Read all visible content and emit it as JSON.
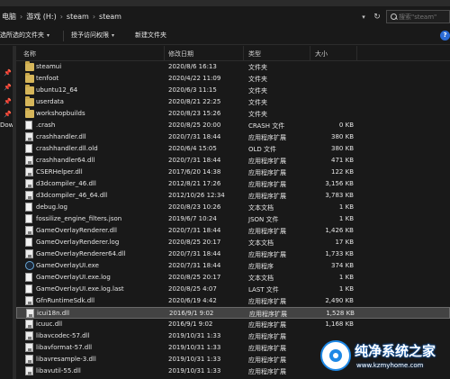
{
  "address": {
    "crumbs": [
      "电脑",
      "游戏 (H:)",
      "steam",
      "steam"
    ],
    "separator": "›",
    "chevron_icon": "▾",
    "refresh_icon": "↻",
    "search_placeholder": "搜索\"steam\""
  },
  "toolbar": {
    "select_label": "选所选的文件夹",
    "share_label": "授予访问权限",
    "new_folder_label": "新建文件夹",
    "chevron_icon": "▾",
    "help_icon": "?"
  },
  "nav": {
    "pin_icon": "📌",
    "downloads_label": "Dow"
  },
  "columns": {
    "name": "名称",
    "date": "修改日期",
    "type": "类型",
    "size": "大小"
  },
  "files": [
    {
      "name": "steamui",
      "date": "2020/8/6 16:13",
      "type": "文件夹",
      "size": "",
      "icon": "folder"
    },
    {
      "name": "tenfoot",
      "date": "2020/4/22 11:09",
      "type": "文件夹",
      "size": "",
      "icon": "folder"
    },
    {
      "name": "ubuntu12_64",
      "date": "2020/6/3 11:15",
      "type": "文件夹",
      "size": "",
      "icon": "folder"
    },
    {
      "name": "userdata",
      "date": "2020/8/21 22:25",
      "type": "文件夹",
      "size": "",
      "icon": "folder"
    },
    {
      "name": "workshopbuilds",
      "date": "2020/8/23 15:26",
      "type": "文件夹",
      "size": "",
      "icon": "folder"
    },
    {
      "name": ".crash",
      "date": "2020/8/25 20:00",
      "type": "CRASH 文件",
      "size": "0 KB",
      "icon": "file"
    },
    {
      "name": "crashhandler.dll",
      "date": "2020/7/31 18:44",
      "type": "应用程序扩展",
      "size": "380 KB",
      "icon": "dll"
    },
    {
      "name": "crashhandler.dll.old",
      "date": "2020/6/4 15:05",
      "type": "OLD 文件",
      "size": "380 KB",
      "icon": "file"
    },
    {
      "name": "crashhandler64.dll",
      "date": "2020/7/31 18:44",
      "type": "应用程序扩展",
      "size": "471 KB",
      "icon": "dll"
    },
    {
      "name": "CSERHelper.dll",
      "date": "2017/6/20 14:38",
      "type": "应用程序扩展",
      "size": "122 KB",
      "icon": "dll"
    },
    {
      "name": "d3dcompiler_46.dll",
      "date": "2012/8/21 17:26",
      "type": "应用程序扩展",
      "size": "3,156 KB",
      "icon": "dll"
    },
    {
      "name": "d3dcompiler_46_64.dll",
      "date": "2012/10/26 12:34",
      "type": "应用程序扩展",
      "size": "3,783 KB",
      "icon": "dll"
    },
    {
      "name": "debug.log",
      "date": "2020/8/23 10:26",
      "type": "文本文档",
      "size": "1 KB",
      "icon": "file"
    },
    {
      "name": "fossilize_engine_filters.json",
      "date": "2019/6/7 10:24",
      "type": "JSON 文件",
      "size": "1 KB",
      "icon": "file"
    },
    {
      "name": "GameOverlayRenderer.dll",
      "date": "2020/7/31 18:44",
      "type": "应用程序扩展",
      "size": "1,426 KB",
      "icon": "dll"
    },
    {
      "name": "GameOverlayRenderer.log",
      "date": "2020/8/25 20:17",
      "type": "文本文档",
      "size": "17 KB",
      "icon": "file"
    },
    {
      "name": "GameOverlayRenderer64.dll",
      "date": "2020/7/31 18:44",
      "type": "应用程序扩展",
      "size": "1,733 KB",
      "icon": "dll"
    },
    {
      "name": "GameOverlayUI.exe",
      "date": "2020/7/31 18:44",
      "type": "应用程序",
      "size": "374 KB",
      "icon": "exe"
    },
    {
      "name": "GameOverlayUI.exe.log",
      "date": "2020/8/25 20:17",
      "type": "文本文档",
      "size": "1 KB",
      "icon": "file"
    },
    {
      "name": "GameOverlayUI.exe.log.last",
      "date": "2020/8/25 4:07",
      "type": "LAST 文件",
      "size": "1 KB",
      "icon": "file"
    },
    {
      "name": "GfnRuntimeSdk.dll",
      "date": "2020/6/19 4:42",
      "type": "应用程序扩展",
      "size": "2,490 KB",
      "icon": "dll"
    },
    {
      "name": "icui18n.dll",
      "date": "2016/9/1 9:02",
      "type": "应用程序扩展",
      "size": "1,528 KB",
      "icon": "dll"
    },
    {
      "name": "icuuc.dll",
      "date": "2016/9/1 9:02",
      "type": "应用程序扩展",
      "size": "1,168 KB",
      "icon": "dll"
    },
    {
      "name": "libavcodec-57.dll",
      "date": "2019/10/31 1:33",
      "type": "应用程序扩展",
      "size": "",
      "icon": "dll"
    },
    {
      "name": "libavformat-57.dll",
      "date": "2019/10/31 1:33",
      "type": "应用程序扩展",
      "size": "",
      "icon": "dll"
    },
    {
      "name": "libavresample-3.dll",
      "date": "2019/10/31 1:33",
      "type": "应用程序扩展",
      "size": "",
      "icon": "dll"
    },
    {
      "name": "libavutil-55.dll",
      "date": "2019/10/31 1:33",
      "type": "应用程序扩展",
      "size": "",
      "icon": "dll"
    }
  ],
  "selected_file": "icui18n.dll",
  "watermark": {
    "title": "纯净系统之家",
    "url": "www.kzmyhome.com"
  }
}
